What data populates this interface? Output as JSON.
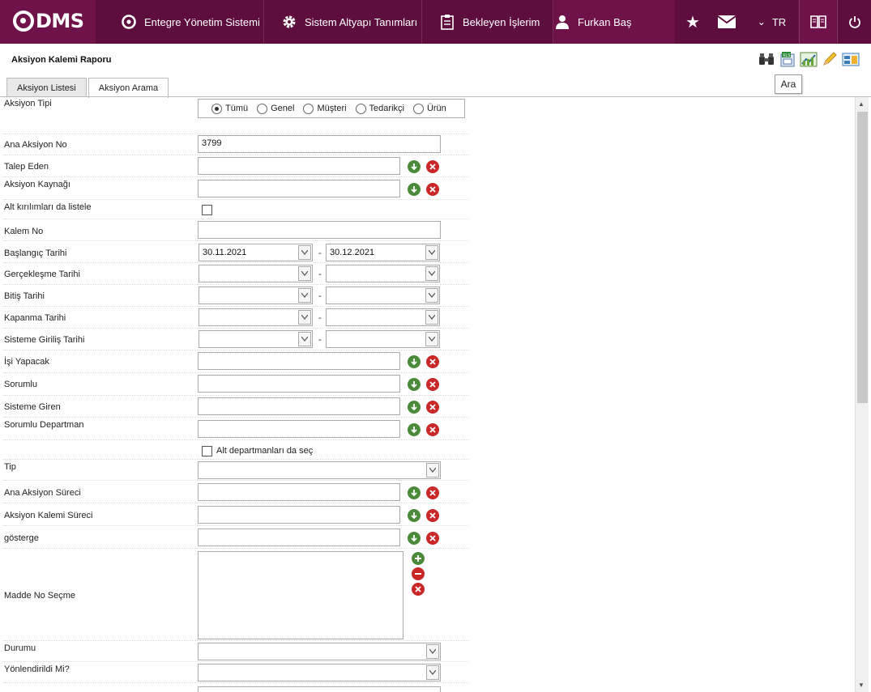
{
  "nav": {
    "logo": "DMS",
    "dms_label": "Entegre Yönetim Sistemi",
    "sys_label": "Sistem Altyapı Tanımları",
    "wait_label": "Bekleyen İşlerim",
    "user_label": "Furkan Baş",
    "lang": "TR"
  },
  "report": {
    "title": "Aksiyon Kalemi Raporu",
    "tooltip": "Ara"
  },
  "tabs": [
    {
      "label": "Aksiyon Listesi"
    },
    {
      "label": "Aksiyon Arama"
    }
  ],
  "form": {
    "aksiyon_tipi": {
      "label": "Aksiyon Tipi",
      "options": [
        "Tümü",
        "Genel",
        "Müşteri",
        "Tedarikçi",
        "Ürün"
      ],
      "selected": "Tümü"
    },
    "ana_aksiyon_no": {
      "label": "Ana Aksiyon No",
      "value": "3799"
    },
    "talep_eden": {
      "label": "Talep Eden",
      "value": ""
    },
    "aksiyon_kaynagi": {
      "label": "Aksiyon Kaynağı",
      "value": ""
    },
    "alt_kirilimlar": {
      "label": "Alt kırılımları da listele",
      "checked": false
    },
    "kalem_no": {
      "label": "Kalem No",
      "value": ""
    },
    "baslangic_tarihi": {
      "label": "Başlangıç Tarihi",
      "from": "30.11.2021",
      "to": "30.12.2021"
    },
    "gerceklesme_tarihi": {
      "label": "Gerçekleşme Tarihi",
      "from": "",
      "to": ""
    },
    "bitis_tarihi": {
      "label": "Bitiş Tarihi",
      "from": "",
      "to": ""
    },
    "kapanma_tarihi": {
      "label": "Kapanma Tarihi",
      "from": "",
      "to": ""
    },
    "sisteme_giris_tarihi": {
      "label": "Sisteme Giriliş Tarihi",
      "from": "",
      "to": ""
    },
    "isi_yapacak": {
      "label": "İşi Yapacak",
      "value": ""
    },
    "sorumlu": {
      "label": "Sorumlu",
      "value": ""
    },
    "sisteme_giren": {
      "label": "Sisteme Giren",
      "value": ""
    },
    "sorumlu_departman": {
      "label": "Sorumlu Departman",
      "value": ""
    },
    "alt_departmanlar": {
      "label": "Alt departmanları da seç",
      "checked": false
    },
    "tip": {
      "label": "Tip",
      "value": ""
    },
    "ana_aksiyon_sureci": {
      "label": "Ana Aksiyon Süreci",
      "value": ""
    },
    "aksiyon_kalemi_sureci": {
      "label": "Aksiyon Kalemi Süreci",
      "value": ""
    },
    "gosterge": {
      "label": "gösterge",
      "value": ""
    },
    "madde_no_secme": {
      "label": "Madde No Seçme"
    },
    "durumu": {
      "label": "Durumu",
      "value": ""
    },
    "yonlendirildi_mi": {
      "label": "Yönlendirildi Mi?",
      "value": ""
    }
  },
  "colors": {
    "topbar": "#5d0e3e",
    "topbar_accent": "#70124a",
    "add_green": "#4a8a3a",
    "clear_red": "#c82828"
  }
}
